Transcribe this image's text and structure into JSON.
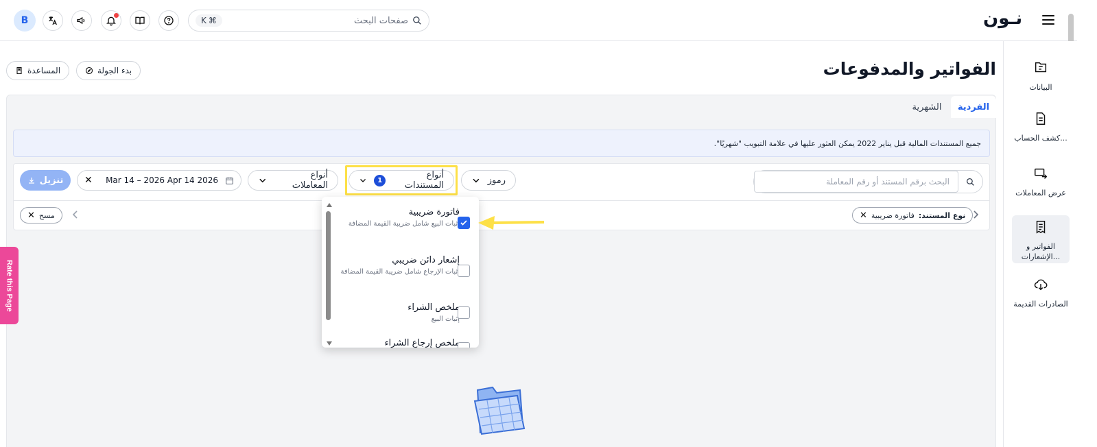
{
  "header": {
    "logo": "نـون",
    "search_placeholder": "صفحات البحث",
    "shortcut_key": "K",
    "avatar_letter": "B"
  },
  "sidebar": {
    "items": [
      {
        "label": "البيانات",
        "icon": "file-dollar-icon"
      },
      {
        "label": "كشف الحساب...",
        "icon": "document-icon"
      },
      {
        "label": "عرض المعاملات",
        "icon": "transactions-icon"
      },
      {
        "label": "الفواتير و الإشعارات...",
        "icon": "receipt-icon",
        "active": true
      },
      {
        "label": "الصادرات القديمة",
        "icon": "cloud-download-icon"
      }
    ]
  },
  "page": {
    "title": "الفواتير والمدفوعات",
    "tour_button": "بدء الجولة",
    "help_button": "المساعدة"
  },
  "tabs": [
    {
      "label": "الفردية",
      "active": true
    },
    {
      "label": "الشهرية",
      "active": false
    }
  ],
  "banner_text": "جميع المستندات المالية قبل يناير 2022 يمكن العثور عليها في علامة التبويب \"شهريًا\".",
  "filters": {
    "search_placeholder": "البحث برقم المستند أو رقم المعاملة",
    "codes_label": "رموز",
    "doc_types_label": "أنواع المستندات",
    "doc_types_count": "1",
    "txn_types_label": "أنواع المعاملات",
    "date_range": "Mar 14 – 2026 Apr 14 2026",
    "download_label": "تنزيل"
  },
  "active_filter_chip": {
    "key": "نوع المستند:",
    "value": "فاتورة ضريبية"
  },
  "clear_chip": "مسح",
  "dropdown_items": [
    {
      "title": "فاتورة ضريبية",
      "subtitle": "إثبات البيع شامل ضريبة القيمة المضافة",
      "checked": true
    },
    {
      "title": "إشعار دائن ضريبي",
      "subtitle": "إثبات الإرجاع شامل ضريبة القيمة المضافة",
      "checked": false
    },
    {
      "title": "ملخص الشراء",
      "subtitle": "إثبات البيع",
      "checked": false
    },
    {
      "title": "ملخص إرجاع الشراء",
      "subtitle": "",
      "checked": false
    }
  ],
  "rate_tab": "Rate this Page",
  "colors": {
    "accent": "#2563eb",
    "highlight": "#fde047",
    "rate_tab": "#ec4899"
  }
}
